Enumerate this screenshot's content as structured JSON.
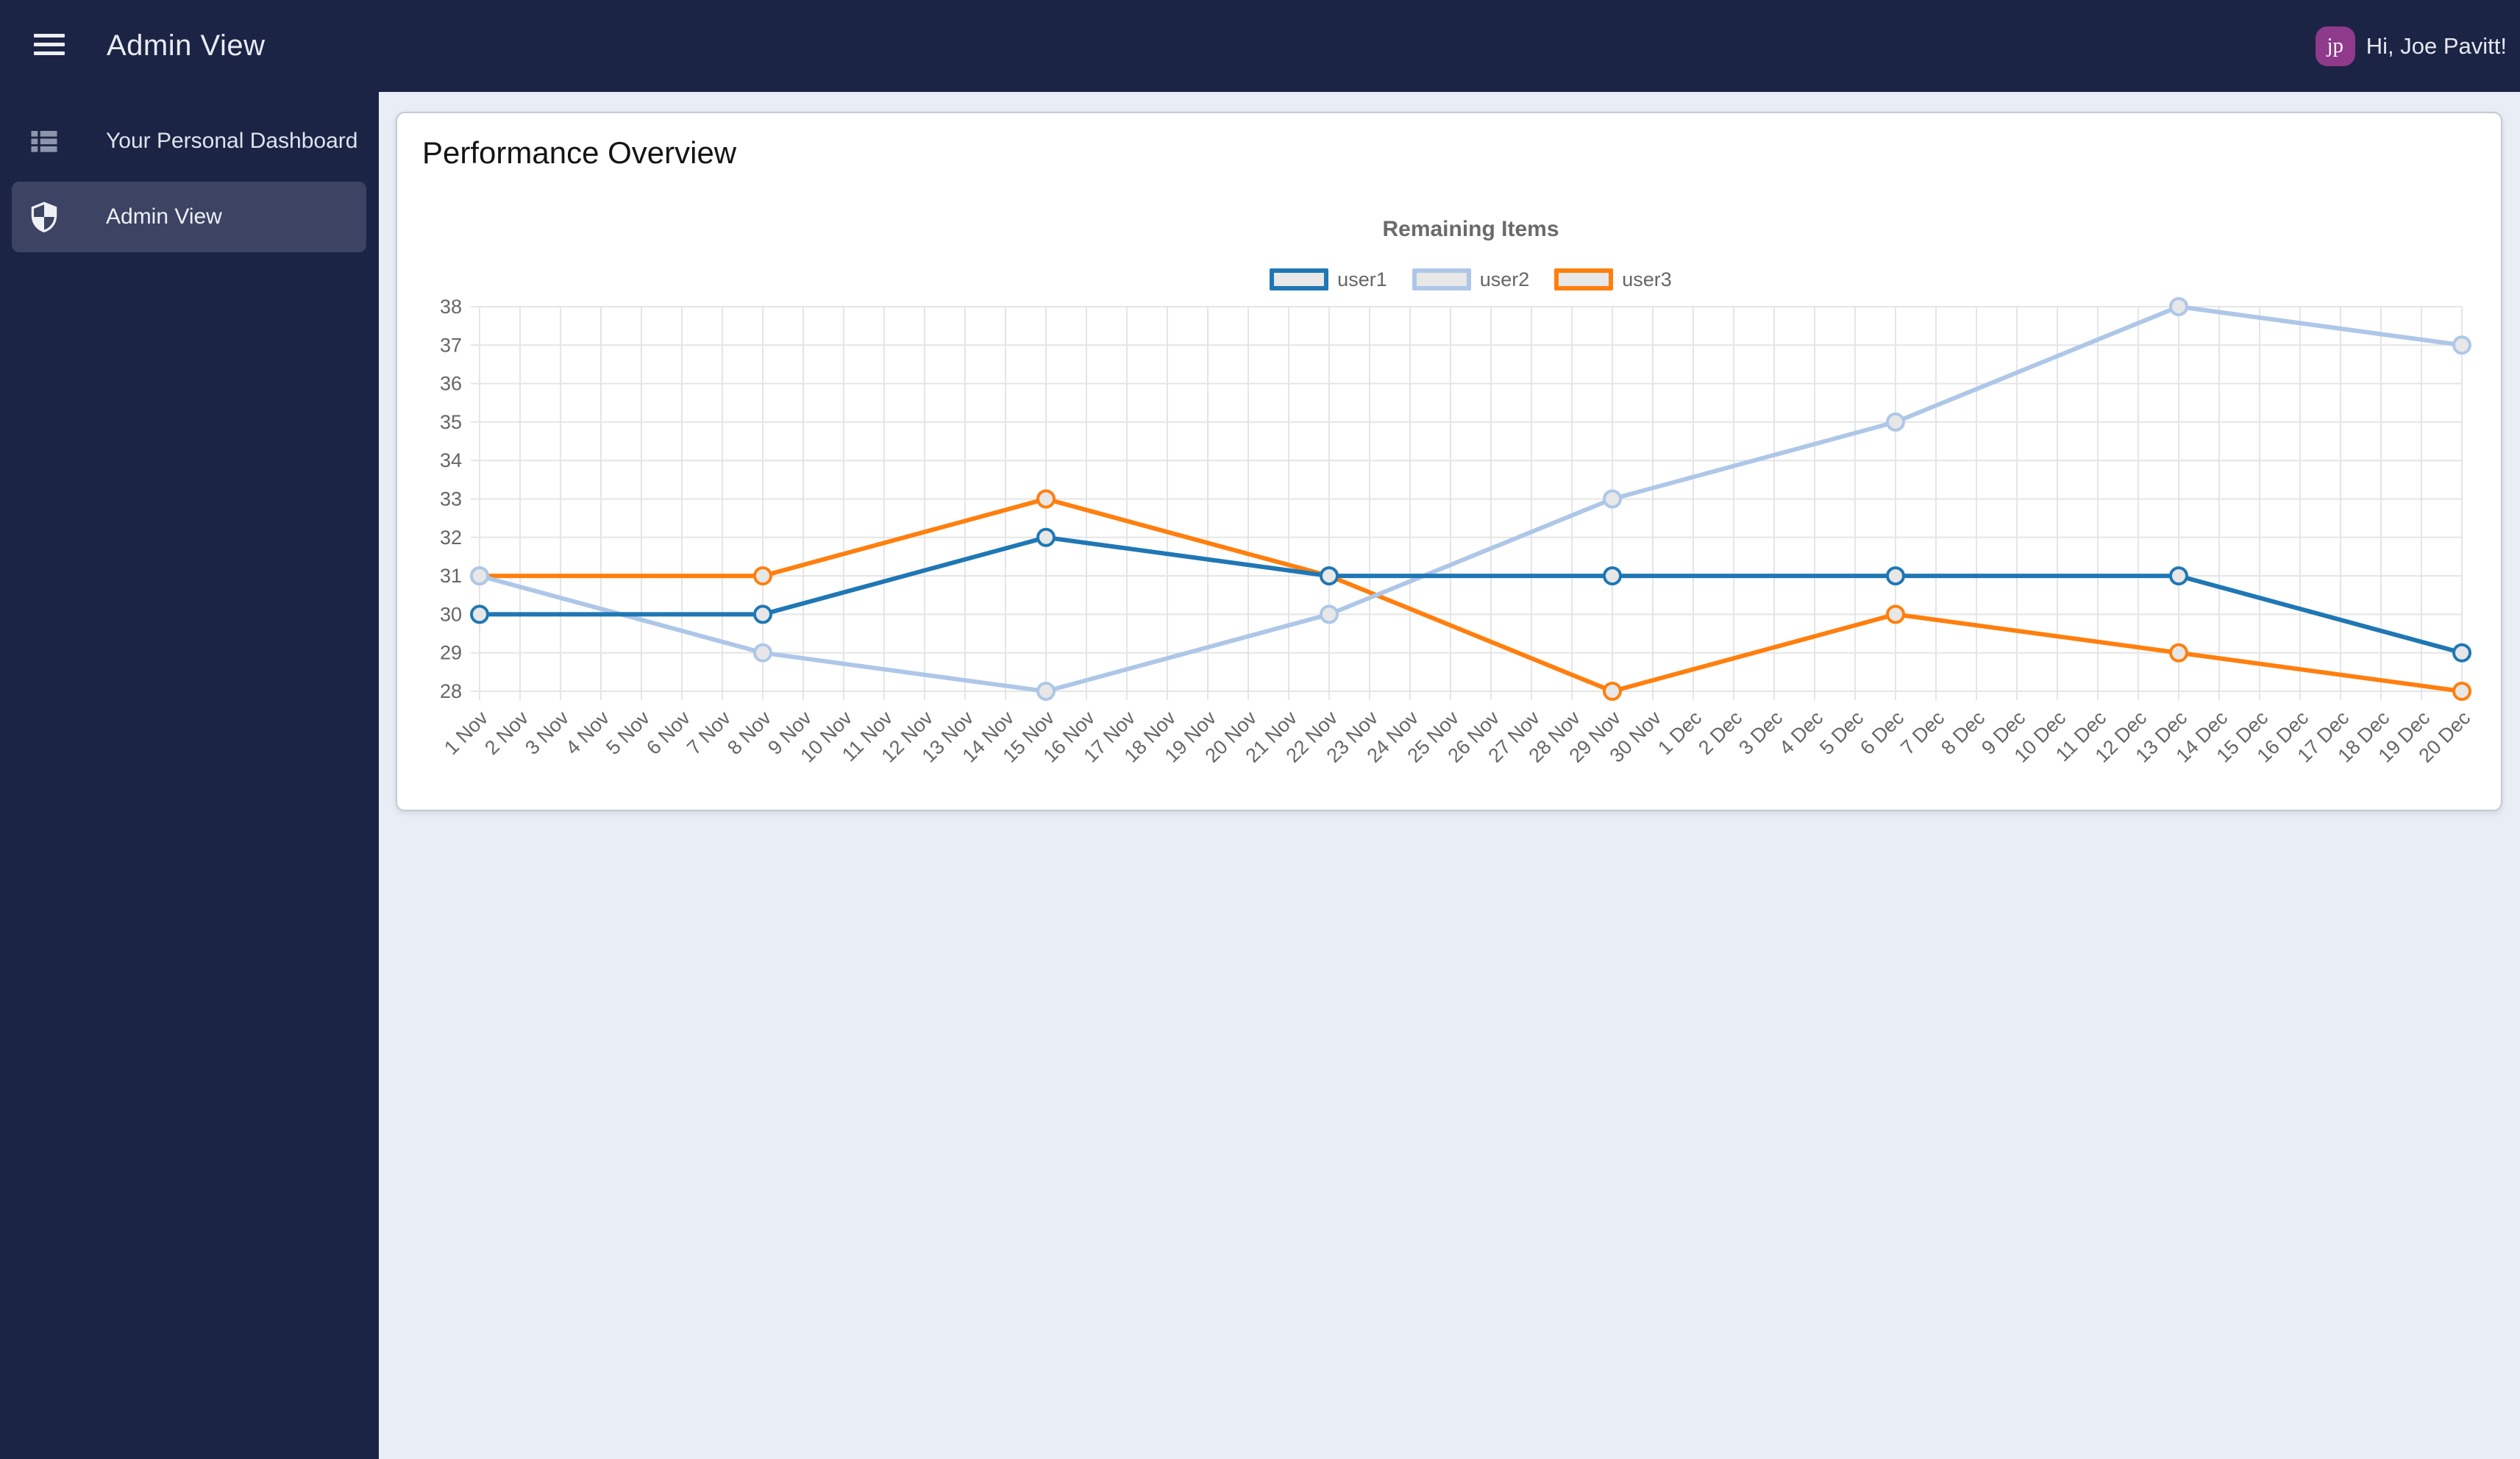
{
  "header": {
    "title": "Admin View",
    "greeting": "Hi, Joe Pavitt!",
    "avatar_initials": "jp"
  },
  "sidebar": {
    "items": [
      {
        "label": "Your Personal Dashboard",
        "icon": "list-icon",
        "active": false
      },
      {
        "label": "Admin View",
        "icon": "shield-icon",
        "active": true
      }
    ]
  },
  "main": {
    "card_title": "Performance Overview"
  },
  "chart_data": {
    "type": "line",
    "title": "Remaining Items",
    "legend_position": "top",
    "grid": true,
    "ylim": [
      28,
      38
    ],
    "y_ticks": [
      38,
      37,
      36,
      35,
      34,
      33,
      32,
      31,
      30,
      29,
      28
    ],
    "x_labels": [
      "1 Nov",
      "2 Nov",
      "3 Nov",
      "4 Nov",
      "5 Nov",
      "6 Nov",
      "7 Nov",
      "8 Nov",
      "9 Nov",
      "10 Nov",
      "11 Nov",
      "12 Nov",
      "13 Nov",
      "14 Nov",
      "15 Nov",
      "16 Nov",
      "17 Nov",
      "18 Nov",
      "19 Nov",
      "20 Nov",
      "21 Nov",
      "22 Nov",
      "23 Nov",
      "24 Nov",
      "25 Nov",
      "26 Nov",
      "27 Nov",
      "28 Nov",
      "29 Nov",
      "30 Nov",
      "1 Dec",
      "2 Dec",
      "3 Dec",
      "4 Dec",
      "5 Dec",
      "6 Dec",
      "7 Dec",
      "8 Dec",
      "9 Dec",
      "10 Dec",
      "11 Dec",
      "12 Dec",
      "13 Dec",
      "14 Dec",
      "15 Dec",
      "16 Dec",
      "17 Dec",
      "18 Dec",
      "19 Dec",
      "20 Dec"
    ],
    "x_data_points": [
      "1 Nov",
      "8 Nov",
      "15 Nov",
      "22 Nov",
      "29 Nov",
      "6 Dec",
      "13 Dec",
      "20 Dec"
    ],
    "series": [
      {
        "name": "user1",
        "color": "#1f77b4",
        "values": [
          30,
          30,
          32,
          31,
          31,
          31,
          31,
          29
        ]
      },
      {
        "name": "user2",
        "color": "#aec7e8",
        "values": [
          31,
          29,
          28,
          30,
          33,
          35,
          38,
          37
        ]
      },
      {
        "name": "user3",
        "color": "#ff7f0e",
        "values": [
          31,
          31,
          33,
          31,
          28,
          30,
          29,
          28
        ]
      }
    ],
    "grid_color": "#e5e5e5",
    "axis_text_color": "#666666",
    "point_fill": "#e7e7e7",
    "legend_box_fill": "#e8e8e8"
  },
  "colors": {
    "header_bg": "#1b2445",
    "sidebar_bg": "#1b2445",
    "sidebar_active_bg": "#3c4363",
    "avatar_bg": "#8f3a8b",
    "main_bg": "#e9edf6",
    "card_bg": "#ffffff",
    "series_user1": "#1f77b4",
    "series_user2": "#aec7e8",
    "series_user3": "#ff7f0e"
  }
}
